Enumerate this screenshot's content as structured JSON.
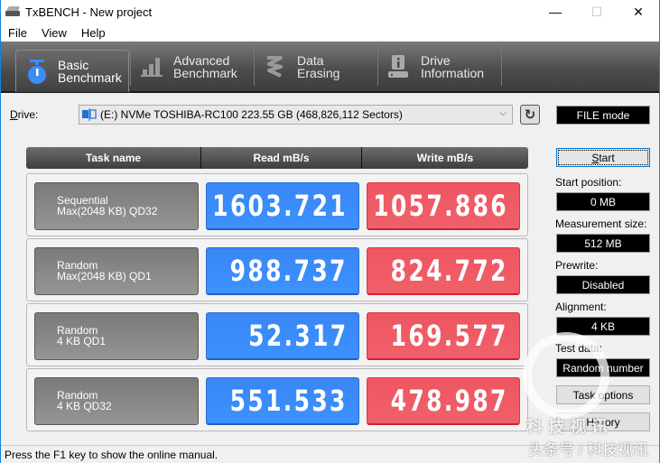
{
  "window": {
    "title": "TxBENCH - New project",
    "controls": {
      "minimize": "—",
      "maximize": "☐",
      "close": "✕"
    }
  },
  "menu": [
    "File",
    "View",
    "Help"
  ],
  "toolbar": {
    "tabs": [
      {
        "line1": "Basic",
        "line2": "Benchmark",
        "icon": "stopwatch-icon",
        "active": true
      },
      {
        "line1": "Advanced",
        "line2": "Benchmark",
        "icon": "bar-chart-icon",
        "active": false
      },
      {
        "line1": "Data Erasing",
        "line2": "",
        "icon": "eraser-icon",
        "active": false
      },
      {
        "line1": "Drive",
        "line2": "Information",
        "icon": "drive-info-icon",
        "active": false
      }
    ]
  },
  "drive": {
    "label_prefix": "D",
    "label_rest": "rive:",
    "selected": "(E:) NVMe TOSHIBA-RC100  223.55 GB (468,826,112 Sectors)",
    "refresh_icon": "↻",
    "mode": "FILE mode"
  },
  "results": {
    "headers": {
      "task": "Task name",
      "read": "Read mB/s",
      "write": "Write mB/s"
    },
    "rows": [
      {
        "task_line1": "Sequential",
        "task_line2": "Max(2048 KB) QD32",
        "read": "1603.721",
        "write": "1057.886"
      },
      {
        "task_line1": "Random",
        "task_line2": "Max(2048 KB) QD1",
        "read": "988.737",
        "write": "824.772"
      },
      {
        "task_line1": "Random",
        "task_line2": "4 KB QD1",
        "read": "52.317",
        "write": "169.577"
      },
      {
        "task_line1": "Random",
        "task_line2": "4 KB QD32",
        "read": "551.533",
        "write": "478.987"
      }
    ],
    "colors": {
      "read": "#3b8cf8",
      "write": "#ef5a64"
    }
  },
  "settings": {
    "start_button_prefix": "S",
    "start_button_rest": "tart",
    "start_position": {
      "label": "Start position:",
      "value": "0 MB"
    },
    "measurement_size": {
      "label": "Measurement size:",
      "value": "512 MB"
    },
    "prewrite": {
      "label": "Prewrite:",
      "value": "Disabled"
    },
    "alignment": {
      "label": "Alignment:",
      "value": "4 KB"
    },
    "test_data": {
      "label": "Test data:",
      "value": "Random number"
    },
    "task_options_label": "Task options",
    "history_label": "History"
  },
  "status": {
    "message": "Press the F1 key to show the online manual."
  },
  "watermark": {
    "logo_text": "科技视讯",
    "caption": "头条号 / 科技视讯"
  }
}
